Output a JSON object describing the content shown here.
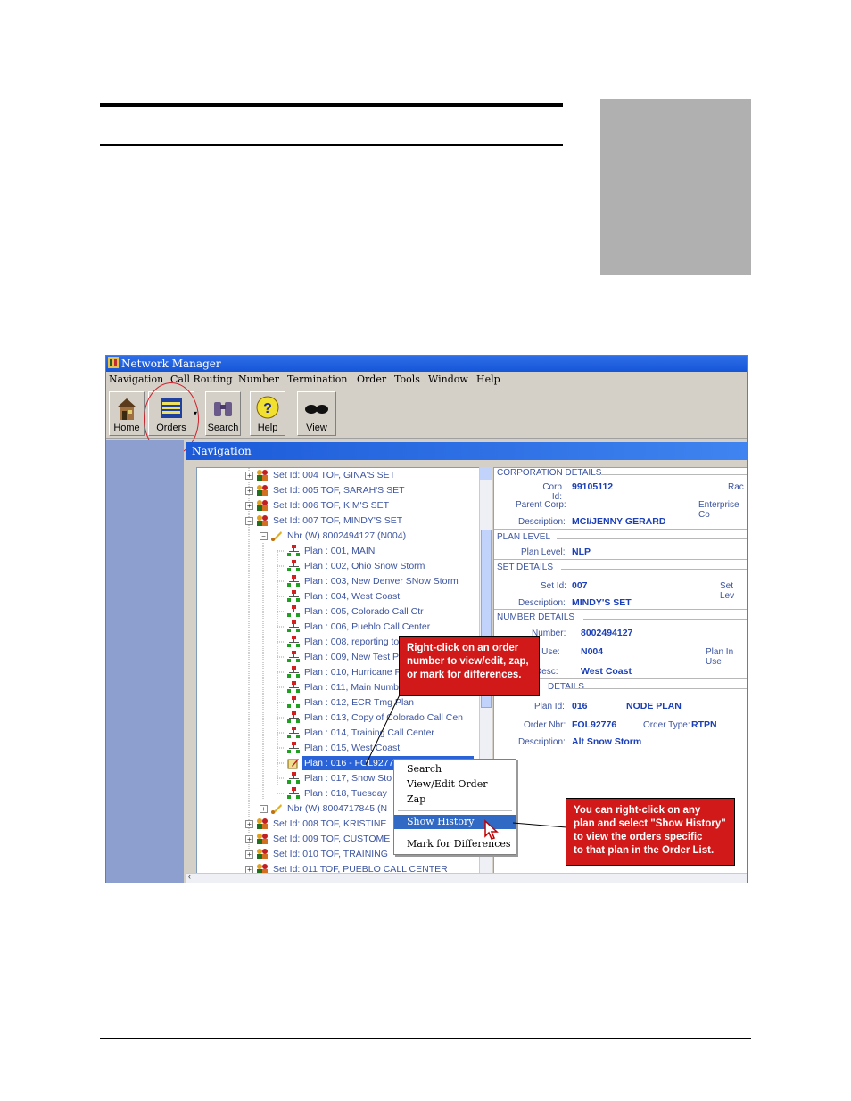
{
  "app": {
    "title": "Network Manager",
    "menu": [
      "Navigation",
      "Call Routing",
      "Number",
      "Termination",
      "Order",
      "Tools",
      "Window",
      "Help"
    ],
    "toolbar": [
      "Home",
      "Orders",
      "Search",
      "Help",
      "View"
    ],
    "nav_title": "Navigation"
  },
  "tree": [
    {
      "label": "Set Id:  004 TOF, GINA'S SET",
      "kind": "set"
    },
    {
      "label": "Set Id:  005 TOF, SARAH'S SET",
      "kind": "set"
    },
    {
      "label": "Set Id:  006 TOF, KIM'S SET",
      "kind": "set"
    },
    {
      "label": "Set Id:  007 TOF, MINDY'S SET",
      "kind": "set"
    },
    {
      "label": "Nbr (W) 8002494127 (N004)",
      "kind": "nbr"
    },
    {
      "label": "Plan : 001, MAIN",
      "kind": "plan"
    },
    {
      "label": "Plan : 002, Ohio Snow Storm",
      "kind": "plan"
    },
    {
      "label": "Plan : 003, New Denver SNow Storm",
      "kind": "plan"
    },
    {
      "label": "Plan : 004, West Coast",
      "kind": "plan"
    },
    {
      "label": "Plan : 005, Colorado Call Ctr",
      "kind": "plan"
    },
    {
      "label": "Plan : 006, Pueblo Call Center",
      "kind": "plan"
    },
    {
      "label": "Plan : 008, reporting to",
      "kind": "plan"
    },
    {
      "label": "Plan : 009, New Test P",
      "kind": "plan"
    },
    {
      "label": "Plan : 010, Hurricane F",
      "kind": "plan"
    },
    {
      "label": "Plan : 011, Main Numb",
      "kind": "plan"
    },
    {
      "label": "Plan : 012, ECR Tmg Plan",
      "kind": "plan"
    },
    {
      "label": "Plan : 013, Copy of Colorado Call Cen",
      "kind": "plan"
    },
    {
      "label": "Plan : 014, Training Call Center",
      "kind": "plan"
    },
    {
      "label": "Plan : 015, West Coast",
      "kind": "plan"
    },
    {
      "label": "Plan : 016 - FOL92776, Alt Snow Sto",
      "kind": "plan"
    },
    {
      "label": "Plan : 017, Snow Sto",
      "kind": "plan"
    },
    {
      "label": "Plan : 018, Tuesday",
      "kind": "plan"
    },
    {
      "label": "Nbr (W) 8004717845 (N",
      "kind": "nbr"
    },
    {
      "label": "Set Id:  008 TOF, KRISTINE",
      "kind": "set"
    },
    {
      "label": "Set Id:  009 TOF, CUSTOME",
      "kind": "set"
    },
    {
      "label": "Set Id:  010 TOF, TRAINING",
      "kind": "set"
    },
    {
      "label": "Set Id:  011 TOF, PUEBLO CALL CENTER",
      "kind": "set"
    }
  ],
  "details": {
    "corp_section": "CORPORATION DETAILS",
    "corp_id_label": "Corp Id:",
    "corp_id": "99105112",
    "rac_label": "Rac",
    "parent_corp_label": "Parent Corp:",
    "enterprise_label": "Enterprise Co",
    "corp_desc_label": "Description:",
    "corp_desc": "MCI/JENNY GERARD",
    "plan_level_section": "PLAN LEVEL",
    "plan_level_label": "Plan Level:",
    "plan_level": "NLP",
    "set_section": "SET DETAILS",
    "set_id_label": "Set Id:",
    "set_id": "007",
    "set_lev_label": "Set Lev",
    "set_desc_label": "Description:",
    "set_desc": "MINDY'S SET",
    "number_section": "NUMBER DETAILS",
    "number_label": "Number:",
    "number": "8002494127",
    "in_use_label": "In Use:",
    "in_use": "N004",
    "plan_in_use_label": "Plan In Use",
    "num_desc_label": "Desc:",
    "num_desc": "West Coast",
    "plan_section": "DETAILS",
    "plan_id_label": "Plan Id:",
    "plan_id": "016",
    "plan_type": "NODE PLAN",
    "order_nbr_label": "Order Nbr:",
    "order_nbr": "FOL92776",
    "order_type_label": "Order Type:",
    "order_type": "RTPN",
    "plan_desc_label": "Description:",
    "plan_desc": "Alt Snow Storm"
  },
  "context_menu": [
    "Search",
    "View/Edit Order",
    "Zap",
    "Show History",
    "Mark for Differences"
  ],
  "callouts": {
    "one": [
      "Right-click on an order",
      "number to view/edit, zap,",
      "or mark for differences."
    ],
    "two": [
      "You can right-click on any",
      "plan and select \"Show History\"",
      "to view the orders specific",
      "to that plan in the Order List."
    ]
  },
  "colors": {
    "callout": "#d11919",
    "titlebar": "#1556d8",
    "selection": "#2a62d8"
  }
}
